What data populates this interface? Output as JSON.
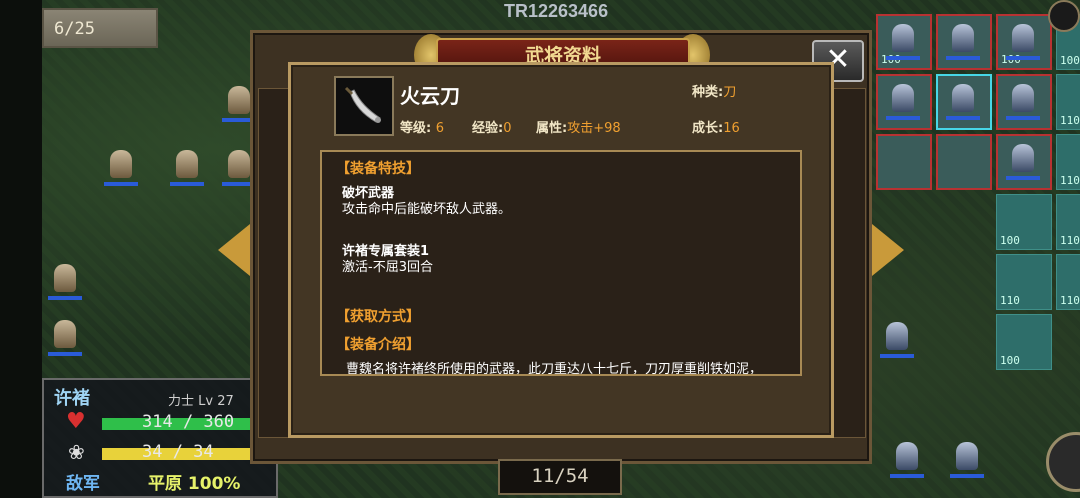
{
  "hud": {
    "turn_counter": "6/25",
    "game_id": "TR12263466",
    "page_indicator": "11/54"
  },
  "unit_status": {
    "name": "许褚",
    "class_level": "力士 Lv 27",
    "hp": "314 / 360",
    "hp_fraction": 0.872,
    "mp": "34 / 34",
    "mp_fraction": 1.0,
    "side": "敌军",
    "terrain": "平原 100%",
    "colors": {
      "hp_bar": "#2fbf4a",
      "mp_bar": "#e8d23a"
    }
  },
  "outer_dialog": {
    "title": "武将资料",
    "close_icon": "close-x-icon"
  },
  "equipment": {
    "name": "火云刀",
    "icon": "broadsword-icon",
    "type_label": "种类:",
    "type_value": "刀",
    "level_label": "等级:",
    "level_value": "6",
    "exp_label": "经验:",
    "exp_value": "0",
    "attr_label": "属性:",
    "attr_value": "攻击+98",
    "growth_label": "成长:",
    "growth_value": "16"
  },
  "details": {
    "skills_header": "【装备特技】",
    "skills": [
      {
        "title": "破坏武器",
        "desc": "攻击命中后能破坏敌人武器。"
      },
      {
        "title": "许褚专属套装1",
        "desc": "激活-不屈3回合"
      }
    ],
    "obtain_header": "【获取方式】",
    "intro_header": "【装备介绍】",
    "intro_text": "曹魏名将许褚终所使用的武器，此刀重达八十七斤，刀刃厚重削铁如泥，"
  },
  "tiles": {
    "labels": [
      "100",
      "100",
      "100",
      "110",
      "100",
      "110",
      "110",
      "110",
      "100",
      "110"
    ]
  },
  "colors": {
    "accent_orange": "#f0a030",
    "frame_gold": "#b99a62",
    "title_plate": "#7a2418",
    "ally_bar": "#2a5bd8"
  }
}
